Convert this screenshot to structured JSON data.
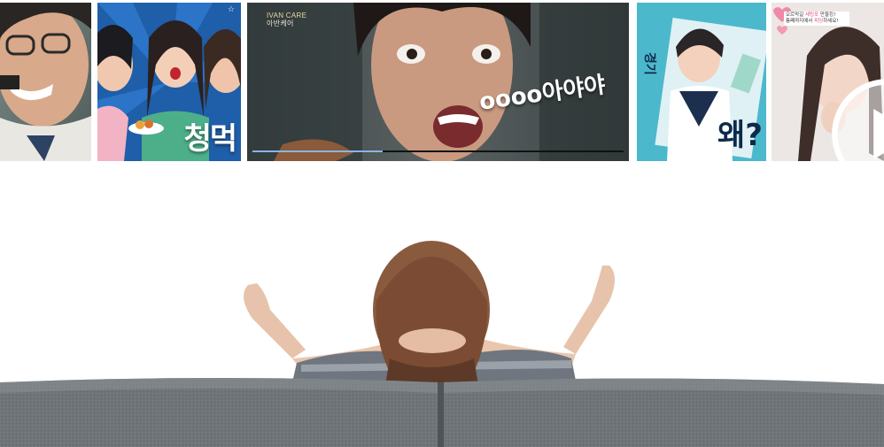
{
  "videos": [
    {
      "id": "v1"
    },
    {
      "id": "v2",
      "title": "청먹"
    },
    {
      "id": "v3",
      "logo": "IVAN CARE",
      "logo_sub": "아반케어",
      "caption": "oooo아야야",
      "progress": 0.35
    },
    {
      "id": "v4",
      "title": "왜?"
    },
    {
      "id": "v5",
      "note_line1": "오르막길 ",
      "note_pink": "세팅포",
      "note_line1_end": " 만들킹!",
      "note_line2": "틈째까지에서 ",
      "note_pink2": "피딩",
      "note_line2_end": "하세요!",
      "play_icon": "play-icon"
    }
  ],
  "colors": {
    "progress_fill": "#88b6e0",
    "progress_track": "#111111",
    "sofa": "#6f7479",
    "poster_blue": "#1f5ea8",
    "poster_teal": "#4cb8cc"
  }
}
